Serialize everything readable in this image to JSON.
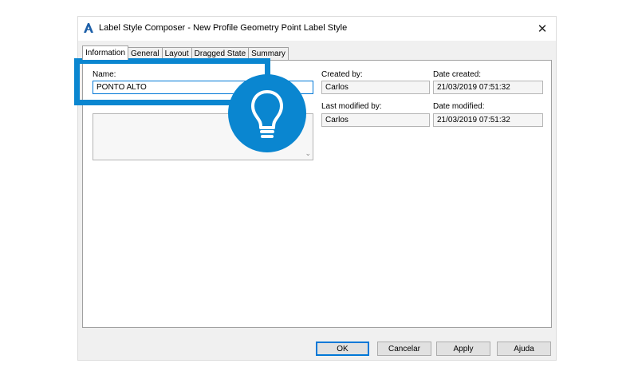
{
  "window": {
    "title": "Label Style Composer - New Profile Geometry Point Label Style",
    "app_icon": "autodesk-a-icon",
    "close_glyph": "✕"
  },
  "tabs": [
    {
      "label": "Information",
      "active": true
    },
    {
      "label": "General",
      "active": false
    },
    {
      "label": "Layout",
      "active": false
    },
    {
      "label": "Dragged State",
      "active": false
    },
    {
      "label": "Summary",
      "active": false
    }
  ],
  "info": {
    "name_label": "Name:",
    "name_value": "PONTO ALTO",
    "created_by_label": "Created by:",
    "created_by_value": "Carlos",
    "date_created_label": "Date created:",
    "date_created_value": "21/03/2019 07:51:32",
    "last_modified_by_label": "Last modified by:",
    "last_modified_by_value": "Carlos",
    "date_modified_label": "Date modified:",
    "date_modified_value": "21/03/2019 07:51:32"
  },
  "buttons": {
    "ok": "OK",
    "cancel": "Cancelar",
    "apply": "Apply",
    "help": "Ajuda"
  },
  "overlay": {
    "icon": "lightbulb-icon",
    "accent_color": "#0a86d0"
  }
}
